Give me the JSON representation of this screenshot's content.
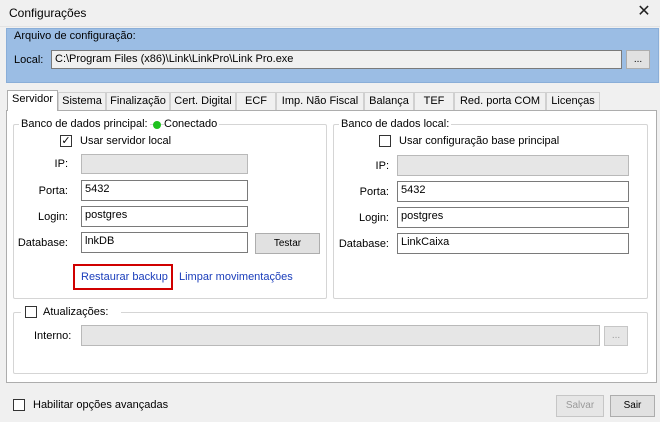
{
  "window": {
    "title": "Configurações",
    "close_glyph": "✕"
  },
  "config_file": {
    "group_label": "Arquivo de configuração:",
    "local_label": "Local:",
    "path": "C:\\Program Files (x86)\\Link\\LinkPro\\Link Pro.exe",
    "browse_label": "..."
  },
  "tabs": [
    {
      "label": "Servidor"
    },
    {
      "label": "Sistema"
    },
    {
      "label": "Finalização"
    },
    {
      "label": "Cert. Digital"
    },
    {
      "label": "ECF"
    },
    {
      "label": "Imp. Não Fiscal"
    },
    {
      "label": "Balança"
    },
    {
      "label": "TEF"
    },
    {
      "label": "Red. porta COM"
    },
    {
      "label": "Licenças"
    }
  ],
  "main_db": {
    "title": "Banco de dados principal:",
    "status": "Conectado",
    "status_color": "#1ec21e",
    "use_local_label": "Usar servidor local",
    "use_local_checked": true,
    "ip_label": "IP:",
    "ip_value": "",
    "port_label": "Porta:",
    "port_value": "5432",
    "login_label": "Login:",
    "login_value": "postgres",
    "database_label": "Database:",
    "database_value": "lnkDB",
    "test_label": "Testar",
    "restore_label": "Restaurar backup",
    "clear_label": "Limpar movimentações"
  },
  "local_db": {
    "title": "Banco de dados local:",
    "use_base_label": "Usar configuração base principal",
    "use_base_checked": false,
    "ip_label": "IP:",
    "ip_value": "",
    "port_label": "Porta:",
    "port_value": "5432",
    "login_label": "Login:",
    "login_value": "postgres",
    "database_label": "Database:",
    "database_value": "LinkCaixa"
  },
  "updates": {
    "label": "Atualizações:",
    "checked": false,
    "internal_label": "Interno:",
    "internal_value": "",
    "browse_label": "..."
  },
  "footer": {
    "advanced_label": "Habilitar opções avançadas",
    "advanced_checked": false,
    "save_label": "Salvar",
    "exit_label": "Sair"
  },
  "colors": {
    "accent_panel": "#9bbde4",
    "highlight_border": "#d00000",
    "link": "#1a3dbb"
  }
}
